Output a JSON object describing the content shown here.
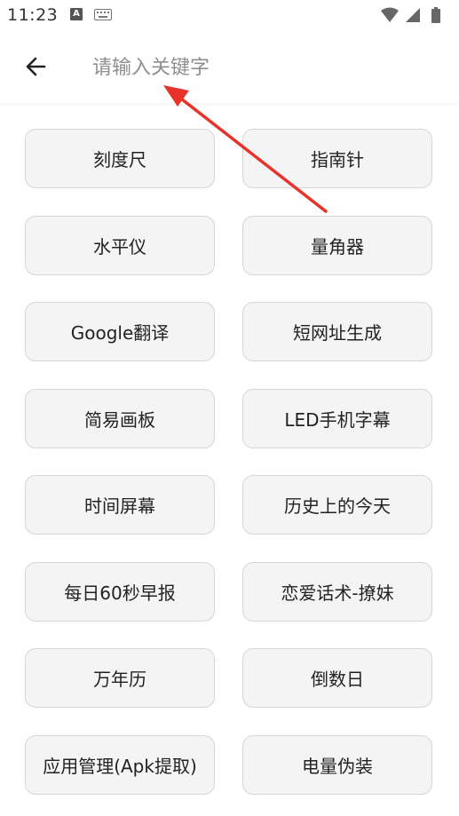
{
  "status_bar": {
    "time": "11:23",
    "notification_letter": "A"
  },
  "header": {
    "search_placeholder": "请输入关键字"
  },
  "tools": [
    "刻度尺",
    "指南针",
    "水平仪",
    "量角器",
    "Google翻译",
    "短网址生成",
    "简易画板",
    "LED手机字幕",
    "时间屏幕",
    "历史上的今天",
    "每日60秒早报",
    "恋爱话术-撩妹",
    "万年历",
    "倒数日",
    "应用管理(Apk提取)",
    "电量伪装"
  ],
  "colors": {
    "annotation_arrow": "#e8322a",
    "button_bg": "#f4f4f4",
    "button_border": "#d6d6d6"
  }
}
